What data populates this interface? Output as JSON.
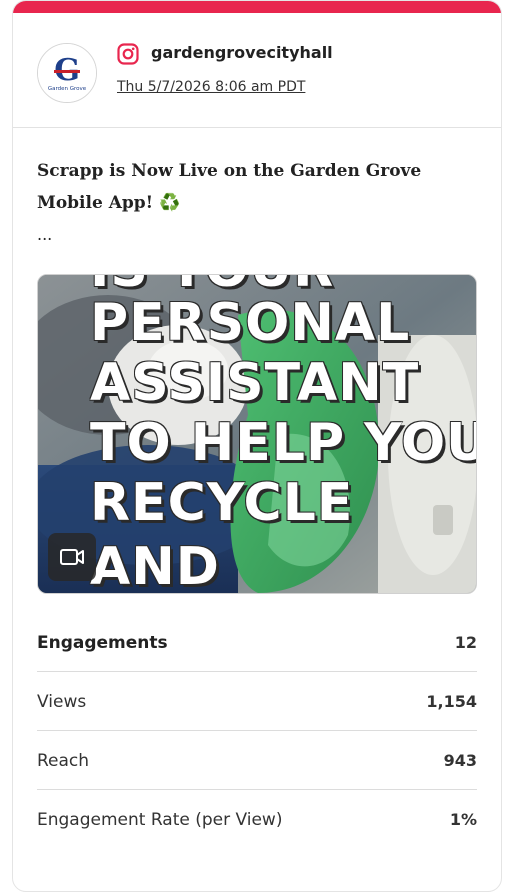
{
  "accent_color": "#e8264e",
  "post": {
    "network_icon": "instagram-icon",
    "avatar_text": "Garden Grove",
    "avatar_letter": "G",
    "username": "gardengrovecityhall",
    "timestamp": "Thu 5/7/2026 8:06 am PDT",
    "body_text": "Scrapp is Now Live on the Garden Grove Mobile App! ♻️",
    "ellipsis": "...",
    "media": {
      "type_icon": "video-icon",
      "overlay_lines": [
        "IS YOUR",
        "PERSONAL",
        "ASSISTANT",
        "TO HELP YOU",
        "RECYCLE",
        "AND"
      ]
    }
  },
  "stats": [
    {
      "label": "Engagements",
      "value": "12"
    },
    {
      "label": "Views",
      "value": "1,154"
    },
    {
      "label": "Reach",
      "value": "943"
    },
    {
      "label": "Engagement Rate (per View)",
      "value": "1%"
    }
  ]
}
